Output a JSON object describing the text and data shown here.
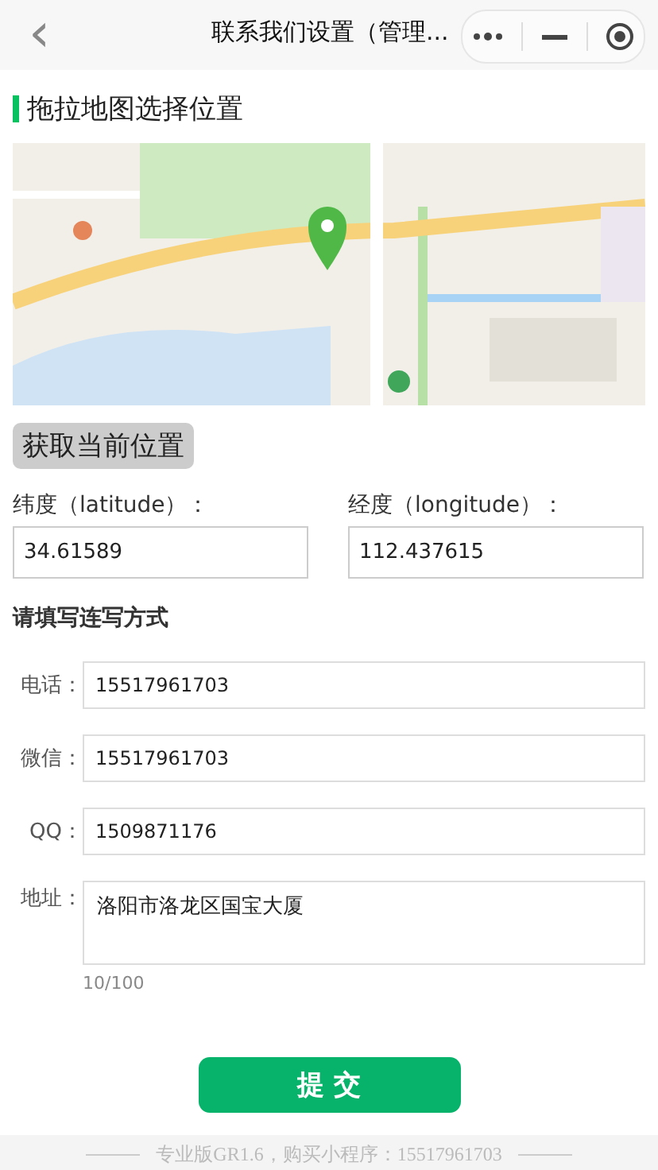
{
  "nav": {
    "back": "‹",
    "title": "联系我们设置（管理..."
  },
  "map_section": {
    "title": "拖拉地图选择位置",
    "locate_button": "获取当前位置"
  },
  "coordinates": [
    {
      "label": "纬度（latitude）：",
      "value": "34.61589"
    },
    {
      "label": "经度（longitude）：",
      "value": "112.437615"
    }
  ],
  "contact": {
    "heading": "请填写连写方式",
    "fields": [
      {
        "kind": "input",
        "label": "电话：",
        "value": "15517961703"
      },
      {
        "kind": "input",
        "label": "微信：",
        "value": "15517961703"
      },
      {
        "kind": "input",
        "label": "QQ：",
        "value": "1509871176"
      },
      {
        "kind": "textarea",
        "label": "地址：",
        "value": "洛阳市洛龙区国宝大厦",
        "counter": "10/100"
      }
    ]
  },
  "submit_button": "提 交",
  "footer": "专业版GR1.6，购买小程序：15517961703"
}
